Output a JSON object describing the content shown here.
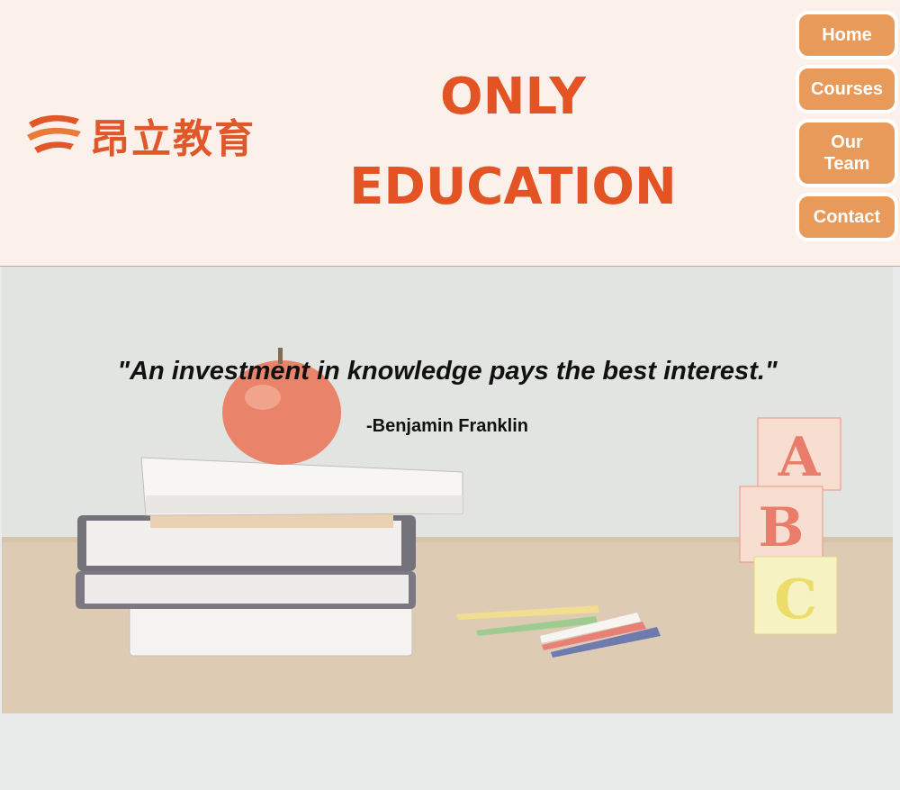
{
  "header": {
    "logo_text": "昂立教育",
    "title_line1": "ONLY",
    "title_line2": "EDUCATION"
  },
  "nav": {
    "items": [
      {
        "label": "Home"
      },
      {
        "label": "Courses"
      },
      {
        "label": "Our Team"
      },
      {
        "label": "Contact"
      }
    ]
  },
  "hero": {
    "quote": "\"An investment in knowledge pays the best interest.\"",
    "author": "-Benjamin Franklin",
    "blocks": [
      "A",
      "B",
      "C"
    ]
  },
  "colors": {
    "brand": "#e45324",
    "nav_button": "#e89a5a",
    "header_bg": "#fcf1ea"
  }
}
